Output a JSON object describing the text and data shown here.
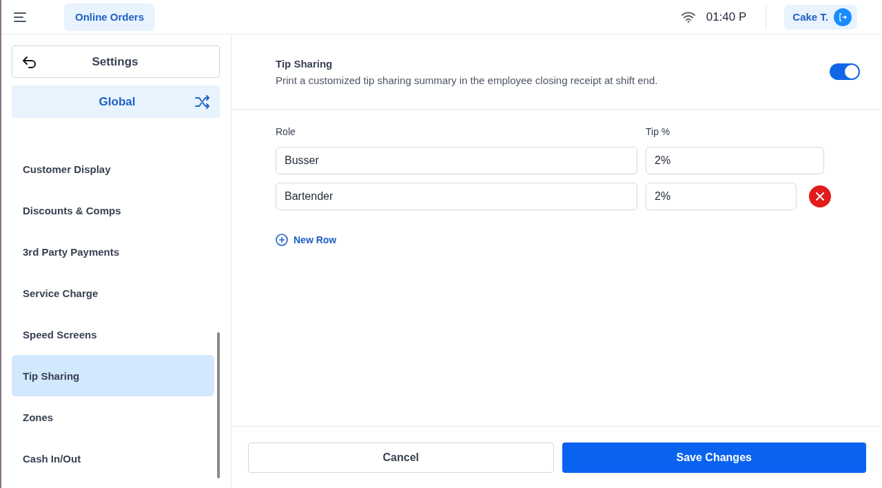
{
  "top_bar": {
    "tab": {
      "label": "Online Orders",
      "selected": true
    },
    "time": "01:40 P",
    "user": "Cake T."
  },
  "sidebar": {
    "back_label": "Settings",
    "scope": "Global",
    "items": [
      {
        "label": "Customer Display",
        "selected": false
      },
      {
        "label": "Discounts & Comps",
        "selected": false
      },
      {
        "label": "3rd Party Payments",
        "selected": false
      },
      {
        "label": "Service Charge",
        "selected": false
      },
      {
        "label": "Speed Screens",
        "selected": false
      },
      {
        "label": "Tip Sharing",
        "selected": true
      },
      {
        "label": "Zones",
        "selected": false
      },
      {
        "label": "Cash In/Out",
        "selected": false
      }
    ]
  },
  "setting": {
    "title": "Tip Sharing",
    "description": "Print a customized tip sharing summary in the employee closing receipt at shift end.",
    "on": true
  },
  "table": {
    "columns": [
      "Role",
      "Tip %"
    ],
    "rows": [
      {
        "role": "Busser",
        "tip": "2%",
        "removable": false
      },
      {
        "role": "Bartender",
        "tip": "2%",
        "removable": true
      }
    ],
    "add_label": "New Row"
  },
  "buttons": {
    "cancel": "Cancel",
    "save": "Save Changes"
  }
}
